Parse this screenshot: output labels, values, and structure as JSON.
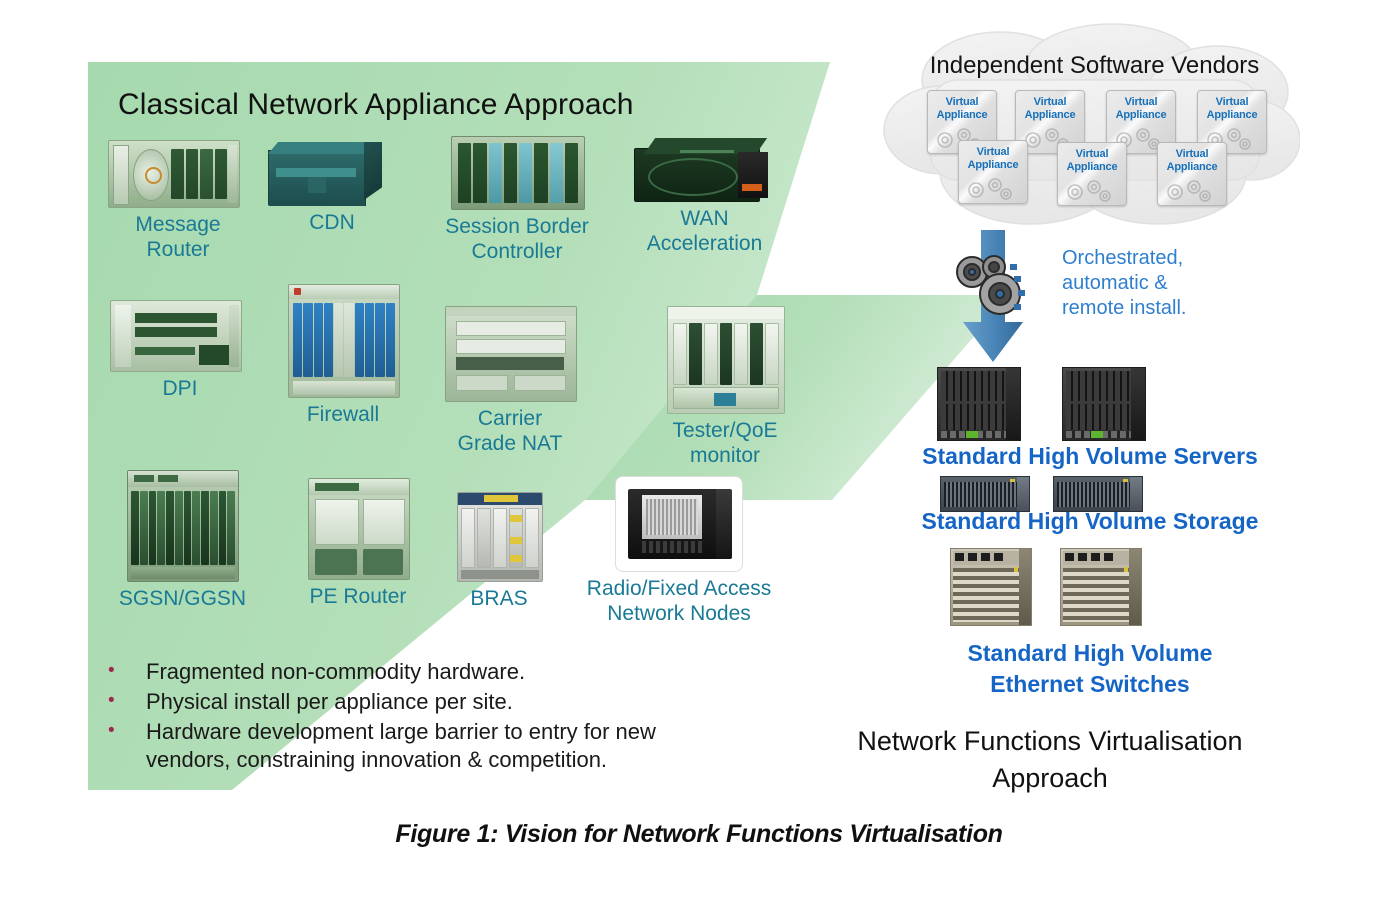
{
  "figure": {
    "caption": "Figure 1: Vision for Network Functions Virtualisation"
  },
  "left_panel": {
    "title": "Classical Network Appliance Approach",
    "panel_color": "#a9dcb0",
    "label_color": "#1a7a96",
    "appliances": [
      {
        "label": "Message\nRouter",
        "icon": "rack-server-icon"
      },
      {
        "label": "CDN",
        "icon": "box-server-icon"
      },
      {
        "label": "Session Border\nController",
        "icon": "blade-chassis-icon"
      },
      {
        "label": "WAN\nAcceleration",
        "icon": "wan-appliance-icon"
      },
      {
        "label": "DPI",
        "icon": "dpi-appliance-icon"
      },
      {
        "label": "Firewall",
        "icon": "firewall-chassis-icon"
      },
      {
        "label": "Carrier\nGrade NAT",
        "icon": "nat-chassis-icon"
      },
      {
        "label": "Tester/QoE\nmonitor",
        "icon": "tester-chassis-icon"
      },
      {
        "label": "SGSN/GGSN",
        "icon": "sgsn-chassis-icon"
      },
      {
        "label": "PE Router",
        "icon": "pe-router-icon"
      },
      {
        "label": "BRAS",
        "icon": "bras-chassis-icon"
      },
      {
        "label": "Radio/Fixed Access\nNetwork Nodes",
        "icon": "access-node-icon"
      }
    ],
    "bullets": [
      "Fragmented non-commodity hardware.",
      "Physical install per appliance per site.",
      "Hardware development large barrier to entry for new vendors, constraining innovation & competition."
    ],
    "bullet_marker": "•",
    "bullet_color": "#9e2a52"
  },
  "right_panel": {
    "title": "Network Functions Virtualisation\nApproach",
    "cloud_label": "Independent Software Vendors",
    "virtual_appliance_label": "Virtual\nAppliance",
    "virtual_appliance_count": 7,
    "va_text_color": "#1771bb",
    "orchestration_note": "Orchestrated,\nautomatic &\nremote install.",
    "orchestration_color": "#2f7fd0",
    "arrow_color": "#4a86b8",
    "hardware_tiers": [
      {
        "label": "Standard High Volume Servers",
        "icon": "blade-server-rack-icon",
        "count": 2
      },
      {
        "label": "Standard High Volume Storage",
        "icon": "storage-array-icon",
        "count": 2
      },
      {
        "label": "Standard High Volume\nEthernet Switches",
        "icon": "ethernet-switch-icon",
        "count": 2
      }
    ],
    "label_color": "#1565c6"
  }
}
